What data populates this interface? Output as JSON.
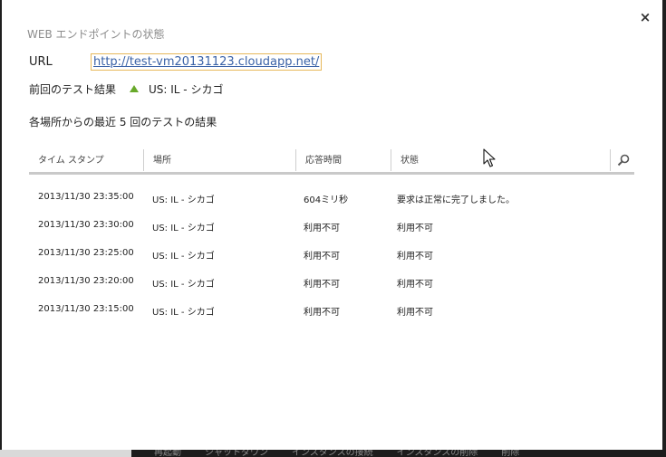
{
  "dialog": {
    "title": "WEB エンドポイントの状態",
    "close_label": "×",
    "url_label": "URL",
    "url_value": "http://test-vm20131123.cloudapp.net/",
    "last_test_label": "前回のテスト結果",
    "last_test_status": "up",
    "last_test_value": "US: IL - シカゴ",
    "section_title": "各場所からの最近 5 回のテストの結果",
    "table": {
      "headers": {
        "timestamp": "タイム スタンプ",
        "location": "場所",
        "response_time": "応答時間",
        "status": "状態"
      },
      "rows": [
        {
          "timestamp": "2013/11/30 23:35:00",
          "location": "US: IL - シカゴ",
          "response_time": "604ミリ秒",
          "status": "要求は正常に完了しました。"
        },
        {
          "timestamp": "2013/11/30 23:30:00",
          "location": "US: IL - シカゴ",
          "response_time": "利用不可",
          "status": "利用不可"
        },
        {
          "timestamp": "2013/11/30 23:25:00",
          "location": "US: IL - シカゴ",
          "response_time": "利用不可",
          "status": "利用不可"
        },
        {
          "timestamp": "2013/11/30 23:20:00",
          "location": "US: IL - シカゴ",
          "response_time": "利用不可",
          "status": "利用不可"
        },
        {
          "timestamp": "2013/11/30 23:15:00",
          "location": "US: IL - シカゴ",
          "response_time": "利用不可",
          "status": "利用不可"
        }
      ]
    }
  },
  "taskbar": {
    "items": [
      "再起動",
      "シャットダウン",
      "インスタンスの接続",
      "インスタンスの削除",
      "",
      "削除"
    ]
  },
  "colors": {
    "status_up": "#68a92a",
    "link": "#3a62a7",
    "link_focus_border": "#e7b85a"
  },
  "icons": {
    "close": "close-icon",
    "search": "search-icon",
    "status": "up-arrow-icon",
    "cursor": "mouse-cursor-icon"
  }
}
